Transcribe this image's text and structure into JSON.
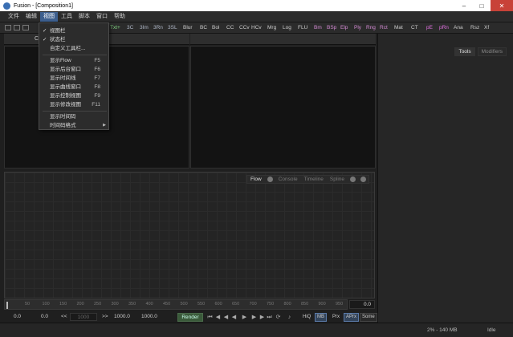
{
  "window": {
    "title": "Fusion - [Composition1]"
  },
  "menu": [
    "文件",
    "编辑",
    "视图",
    "工具",
    "脚本",
    "窗口",
    "帮助"
  ],
  "toolbar": {
    "tools": [
      {
        "label": "Txt+",
        "color": "#7fd07f"
      },
      {
        "label": "3C",
        "color": "#b0b8c8"
      },
      {
        "label": "3Im",
        "color": "#b0b8c8"
      },
      {
        "label": "3Rn",
        "color": "#b0b8c8"
      },
      {
        "label": "3SL",
        "color": "#b0b8c8"
      },
      {
        "label": "Blur",
        "color": "#cccccc"
      },
      {
        "label": "BC",
        "color": "#cccccc"
      },
      {
        "label": "Bol",
        "color": "#cccccc"
      },
      {
        "label": "CC",
        "color": "#cccccc"
      },
      {
        "label": "CCv",
        "color": "#cccccc"
      },
      {
        "label": "HCv",
        "color": "#cccccc"
      },
      {
        "label": "Mrg",
        "color": "#cccccc"
      },
      {
        "label": "Log",
        "color": "#cccccc"
      },
      {
        "label": "FLU",
        "color": "#cccccc"
      },
      {
        "label": "Bm",
        "color": "#d48ad4"
      },
      {
        "label": "BSp",
        "color": "#d48ad4"
      },
      {
        "label": "Elp",
        "color": "#d48ad4"
      },
      {
        "label": "Ply",
        "color": "#d48ad4"
      },
      {
        "label": "Rng",
        "color": "#d48ad4"
      },
      {
        "label": "Rct",
        "color": "#d48ad4"
      },
      {
        "label": "Mat",
        "color": "#cccccc"
      },
      {
        "label": "CT",
        "color": "#cccccc"
      },
      {
        "label": "pE",
        "color": "#e070e0"
      },
      {
        "label": "pRn",
        "color": "#e070e0"
      },
      {
        "label": "Ana",
        "color": "#cccccc"
      },
      {
        "label": "Rsz",
        "color": "#cccccc"
      },
      {
        "label": "Xf",
        "color": "#cccccc"
      }
    ]
  },
  "viewer": {
    "header_label": "Co"
  },
  "view_menu": {
    "items": [
      {
        "label": "视图栏",
        "checked": "✓"
      },
      {
        "label": "状态栏",
        "checked": "✓"
      },
      {
        "label": "自定义工具栏..."
      },
      {
        "label": "显示Flow",
        "shortcut": "F5"
      },
      {
        "label": "显示后台窗口",
        "shortcut": "F6"
      },
      {
        "label": "显示时间线",
        "shortcut": "F7"
      },
      {
        "label": "显示曲线窗口",
        "shortcut": "F8"
      },
      {
        "label": "显示控制视图",
        "shortcut": "F9"
      },
      {
        "label": "显示修改视图",
        "shortcut": "F11"
      },
      {
        "label": "显示时间码"
      },
      {
        "label": "时间码格式",
        "submenu": "▶"
      }
    ]
  },
  "right_panel": {
    "tabs": [
      "Tools",
      "Modifiers"
    ]
  },
  "flow_panel": {
    "tabs": [
      "Flow",
      "Console",
      "Timeline",
      "Spline"
    ]
  },
  "ruler": {
    "ticks": [
      "0",
      "50",
      "100",
      "150",
      "200",
      "250",
      "300",
      "350",
      "400",
      "450",
      "500",
      "550",
      "600",
      "650",
      "700",
      "750",
      "800",
      "850",
      "900",
      "950"
    ]
  },
  "transport": {
    "current_time": "0.0",
    "global_start": "0.0",
    "render_start": "0.0",
    "step_back": "<<",
    "step_value": "1000",
    "step_fwd": ">>",
    "render_end": "1000.0",
    "global_end": "1000.0",
    "render_label": "Render",
    "hiq": "HiQ",
    "mb": "MB",
    "prx": "Prx",
    "aprx": "APrx",
    "some": "Some"
  },
  "status": {
    "memory": "2% - 140 MB",
    "state": "Idle"
  }
}
